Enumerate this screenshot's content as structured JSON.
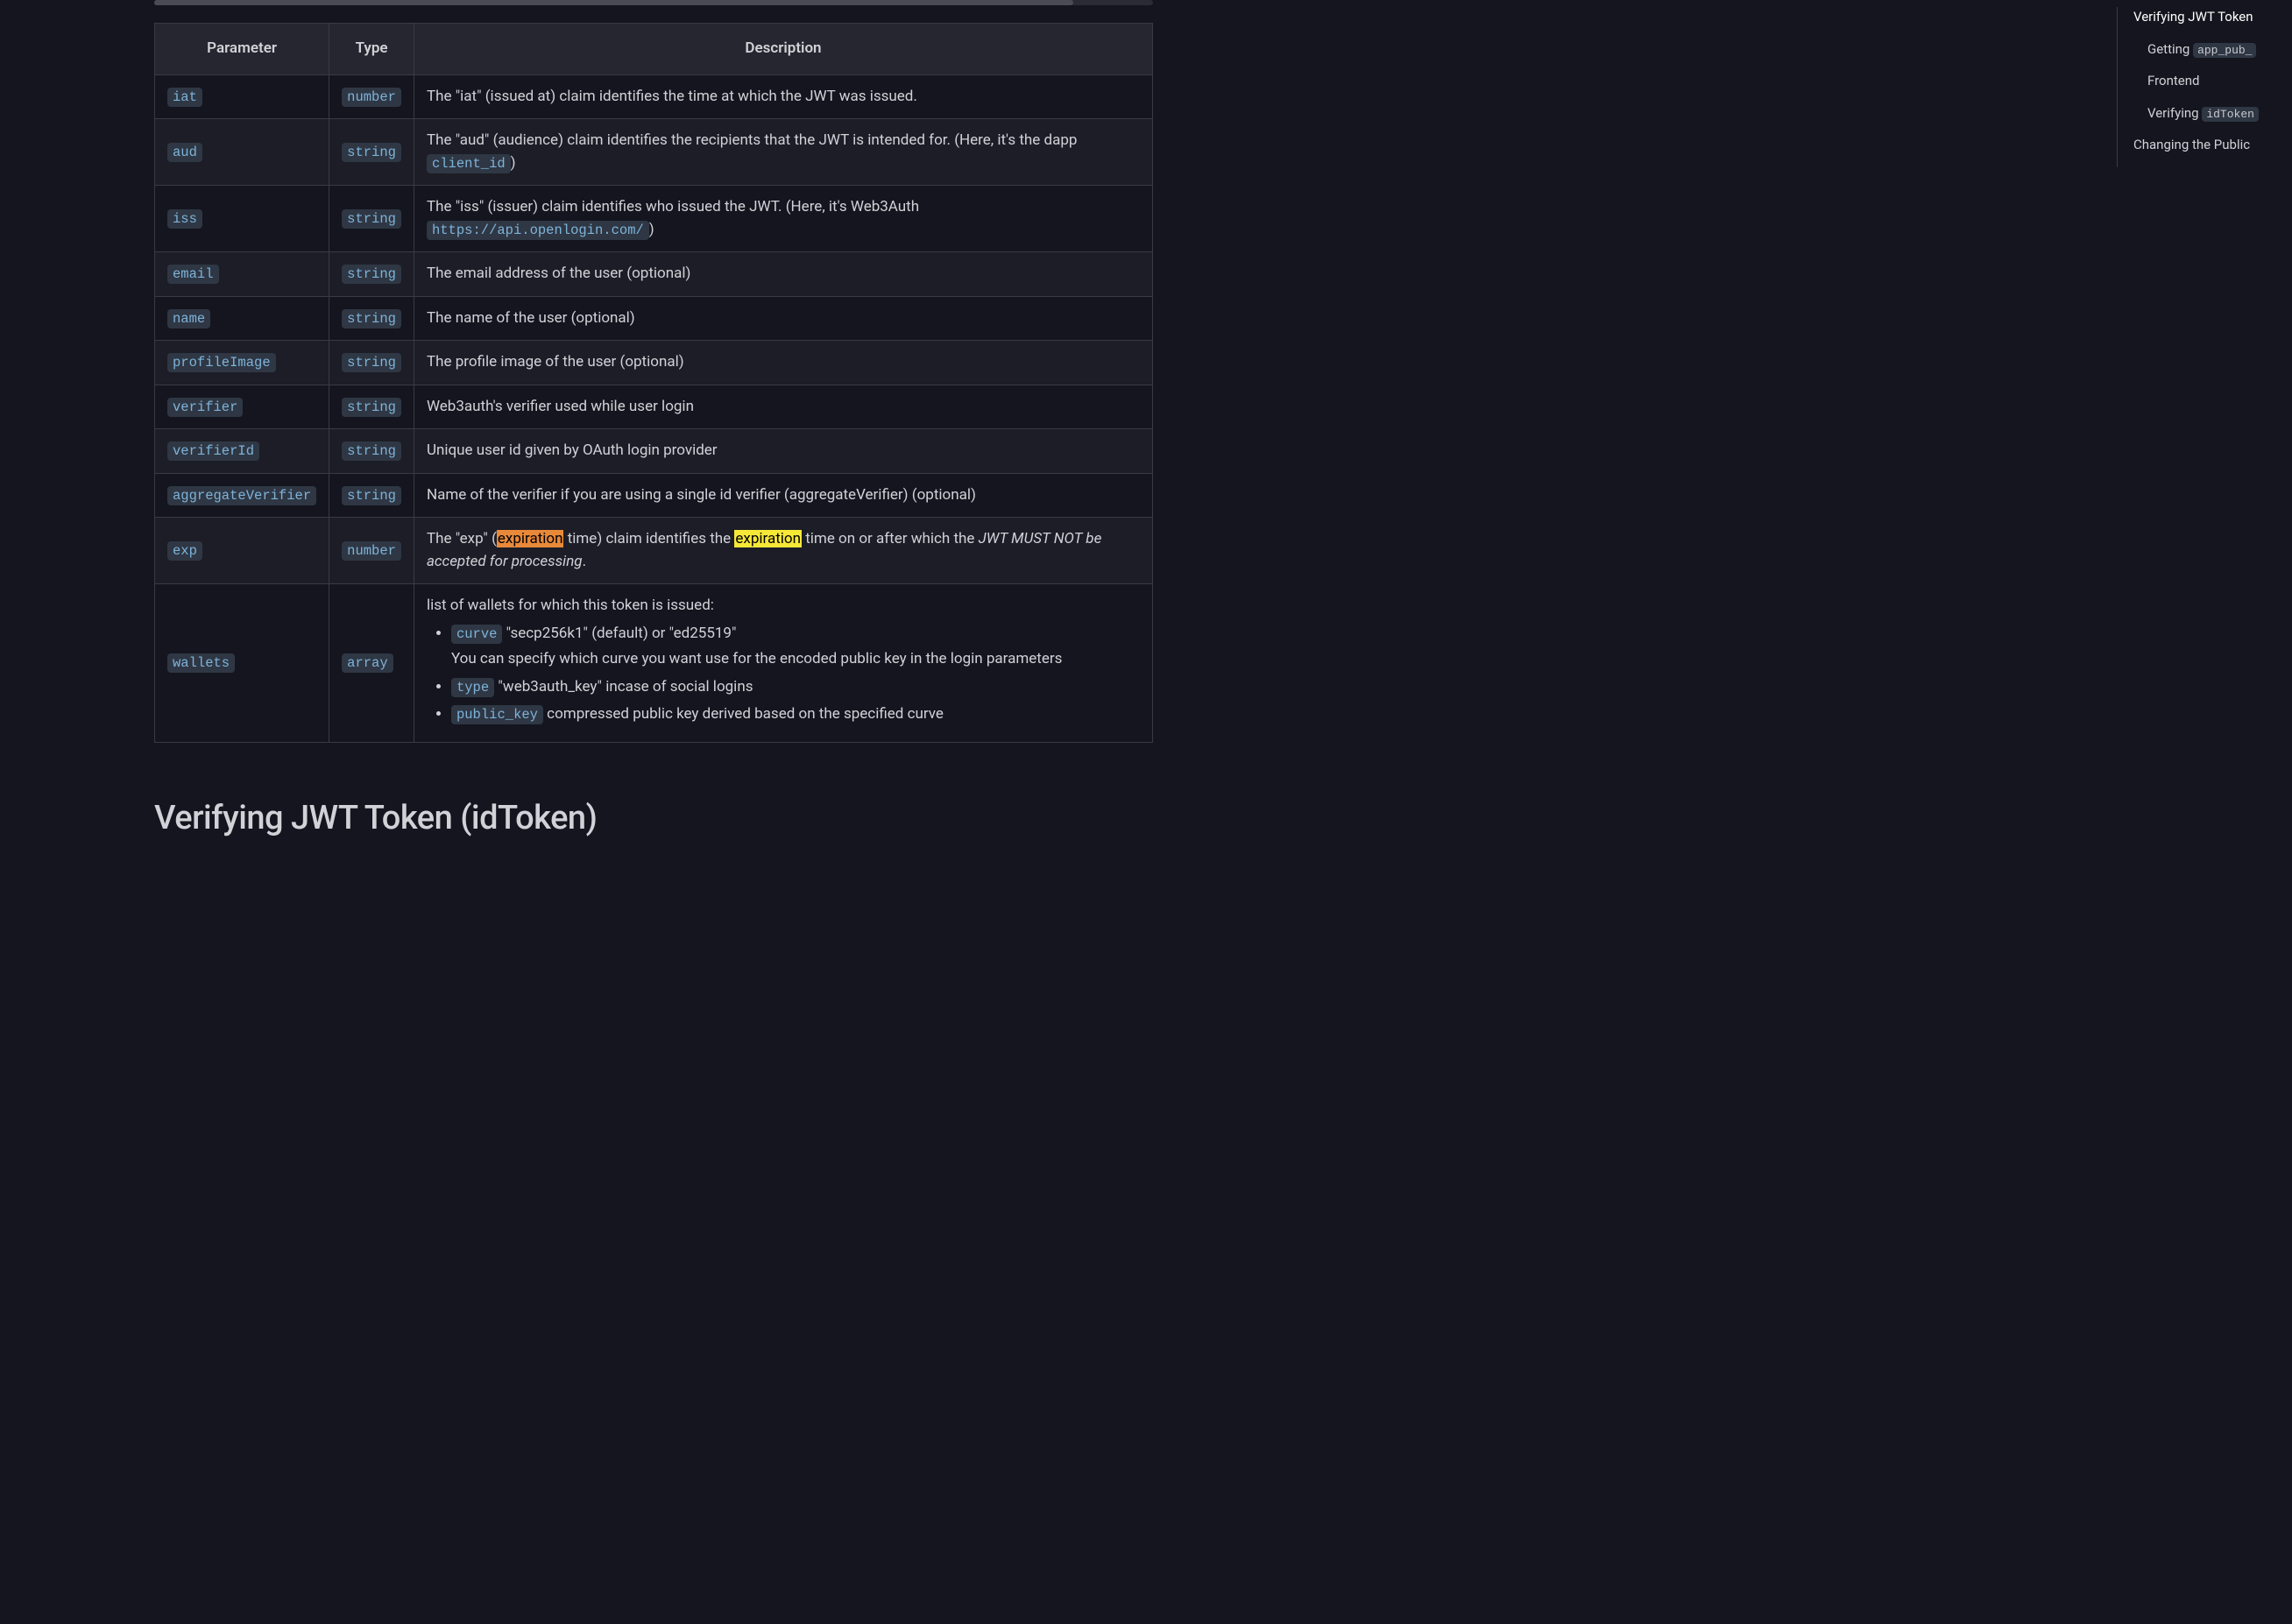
{
  "table": {
    "headers": {
      "parameter": "Parameter",
      "type": "Type",
      "description": "Description"
    },
    "rows": [
      {
        "param": "iat",
        "type": "number",
        "desc_plain": "The \"iat\" (issued at) claim identifies the time at which the JWT was issued."
      },
      {
        "param": "aud",
        "type": "string",
        "desc_prefix": "The \"aud\" (audience) claim identifies the recipients that the JWT is intended for. (Here, it's the dapp ",
        "desc_code": "client_id",
        "desc_suffix": ")"
      },
      {
        "param": "iss",
        "type": "string",
        "desc_prefix": "The \"iss\" (issuer) claim identifies who issued the JWT. (Here, it's Web3Auth ",
        "desc_code": "https://api.openlogin.com/",
        "desc_suffix": ")"
      },
      {
        "param": "email",
        "type": "string",
        "desc_plain": "The email address of the user (optional)"
      },
      {
        "param": "name",
        "type": "string",
        "desc_plain": "The name of the user (optional)"
      },
      {
        "param": "profileImage",
        "type": "string",
        "desc_plain": "The profile image of the user (optional)"
      },
      {
        "param": "verifier",
        "type": "string",
        "desc_plain": "Web3auth's verifier used while user login"
      },
      {
        "param": "verifierId",
        "type": "string",
        "desc_plain": "Unique user id given by OAuth login provider"
      },
      {
        "param": "aggregateVerifier",
        "type": "string",
        "desc_plain": "Name of the verifier if you are using a single id verifier (aggregateVerifier) (optional)"
      },
      {
        "param": "exp",
        "type": "number",
        "exp_p1": "The \"exp\" (",
        "exp_h1": "expiration",
        "exp_p2": " time) claim identifies the ",
        "exp_h2": "expiration",
        "exp_p3": " time on or after which the ",
        "exp_em": "JWT MUST NOT be accepted for processing",
        "exp_p4": "."
      },
      {
        "param": "wallets",
        "type": "array",
        "wallets_intro": "list of wallets for which this token is issued:",
        "wallets_items": [
          {
            "code": "curve",
            "text": " \"secp256k1\" (default) or \"ed25519\"",
            "sub": "You can specify which curve you want use for the encoded public key in the login parameters"
          },
          {
            "code": "type",
            "text": " \"web3auth_key\" incase of social logins"
          },
          {
            "code": "public_key",
            "text": " compressed public key derived based on the specified curve"
          }
        ]
      }
    ]
  },
  "heading": "Verifying JWT Token (idToken)",
  "toc": {
    "item1_text": "Verifying JWT Token",
    "item2_prefix": "Getting ",
    "item2_code": "app_pub_",
    "item3_text": "Frontend",
    "item4_prefix": "Verifying ",
    "item4_code": "idToken",
    "item5_text": "Changing the Public"
  }
}
